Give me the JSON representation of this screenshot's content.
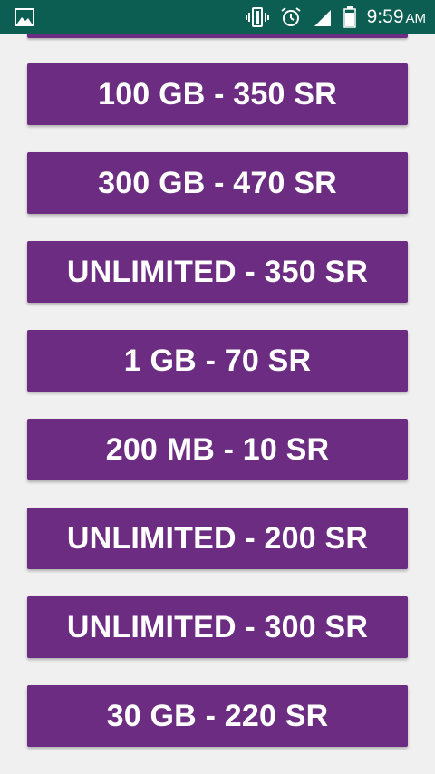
{
  "status_bar": {
    "time": "9:59",
    "ampm": "AM",
    "icons": [
      "image-icon",
      "vibrate-icon",
      "alarm-icon",
      "signal-icon",
      "battery-icon"
    ],
    "background": "#0b5e51"
  },
  "plans": [
    {
      "label": "100 GB - 350 SR"
    },
    {
      "label": "300 GB - 470 SR"
    },
    {
      "label": "UNLIMITED - 350 SR"
    },
    {
      "label": "1 GB - 70 SR"
    },
    {
      "label": "200 MB - 10 SR"
    },
    {
      "label": "UNLIMITED - 200 SR"
    },
    {
      "label": "UNLIMITED - 300 SR"
    },
    {
      "label": "30 GB - 220 SR"
    }
  ],
  "colors": {
    "button": "#6b2c81",
    "page_background": "#f1f0f1",
    "button_text": "#ffffff"
  }
}
